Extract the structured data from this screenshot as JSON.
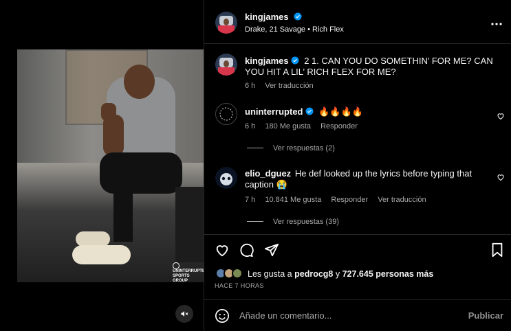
{
  "post": {
    "author": "kingjames",
    "music": "Drake, 21 Savage • Rich Flex",
    "image_logo_text": "UNINTERRUPTED SPORTS GROUP"
  },
  "caption": {
    "author": "kingjames",
    "text": "🅂 [2] [1]. CAN YOU DO SOMETHIN' FOR ME? CAN YOU HIT A LIL' RICH FLEX FOR ME?",
    "text_display": "2 1. CAN YOU DO SOMETHIN’ FOR ME? CAN YOU HIT A LIL’ RICH FLEX FOR ME?",
    "time": "6 h",
    "translate": "Ver traducción"
  },
  "comments": [
    {
      "author": "uninterrupted",
      "text": "🔥🔥🔥🔥",
      "time": "6 h",
      "likes": "180 Me gusta",
      "reply": "Responder",
      "view_replies": "Ver respuestas (2)"
    },
    {
      "author": "elio_dguez",
      "text": "He def looked up the lyrics before typing that caption 😭",
      "time": "7 h",
      "likes": "10.841 Me gusta",
      "reply": "Responder",
      "translate": "Ver traducción",
      "view_replies": "Ver respuestas (39)"
    }
  ],
  "likes": {
    "prefix": "Les gusta a",
    "user": "pedrocg8",
    "middle": " y ",
    "count": "727.645 personas más"
  },
  "timestamp": "HACE 7 HORAS",
  "add_comment": {
    "placeholder": "Añade un comentario...",
    "post_label": "Publicar"
  },
  "colors": {
    "background": "#000000",
    "text": "#f5f5f5",
    "secondary": "#a8a8a8",
    "verified": "#0095f6",
    "divider": "#262626"
  },
  "icons": [
    "verified-icon",
    "more-options-icon",
    "heart-icon",
    "comment-icon",
    "share-icon",
    "save-icon",
    "emoji-icon",
    "mute-icon"
  ]
}
